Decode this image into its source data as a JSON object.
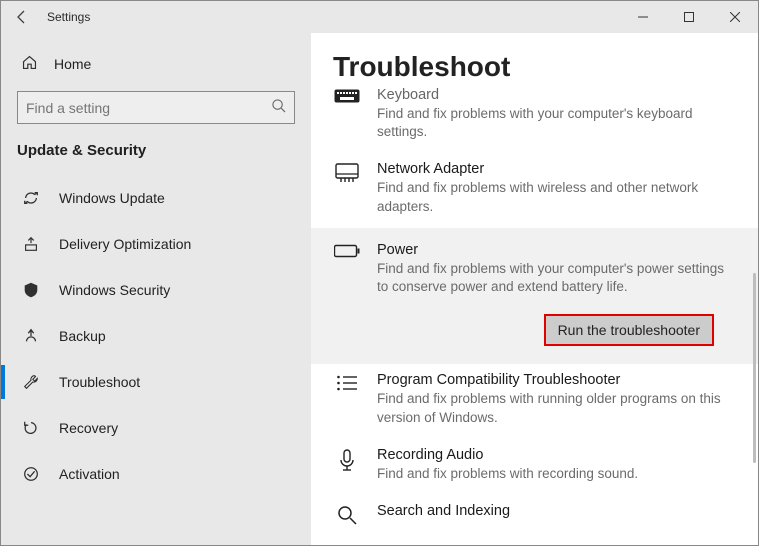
{
  "window": {
    "title": "Settings"
  },
  "sidebar": {
    "home": "Home",
    "search_placeholder": "Find a setting",
    "section": "Update & Security",
    "items": [
      {
        "label": "Windows Update"
      },
      {
        "label": "Delivery Optimization"
      },
      {
        "label": "Windows Security"
      },
      {
        "label": "Backup"
      },
      {
        "label": "Troubleshoot"
      },
      {
        "label": "Recovery"
      },
      {
        "label": "Activation"
      }
    ]
  },
  "content": {
    "heading": "Troubleshoot",
    "run_button": "Run the troubleshooter",
    "items": {
      "keyboard": {
        "title": "Keyboard",
        "desc": "Find and fix problems with your computer's keyboard settings."
      },
      "network": {
        "title": "Network Adapter",
        "desc": "Find and fix problems with wireless and other network adapters."
      },
      "power": {
        "title": "Power",
        "desc": "Find and fix problems with your computer's power settings to conserve power and extend battery life."
      },
      "compat": {
        "title": "Program Compatibility Troubleshooter",
        "desc": "Find and fix problems with running older programs on this version of Windows."
      },
      "audio": {
        "title": "Recording Audio",
        "desc": "Find and fix problems with recording sound."
      },
      "search": {
        "title": "Search and Indexing"
      }
    }
  }
}
